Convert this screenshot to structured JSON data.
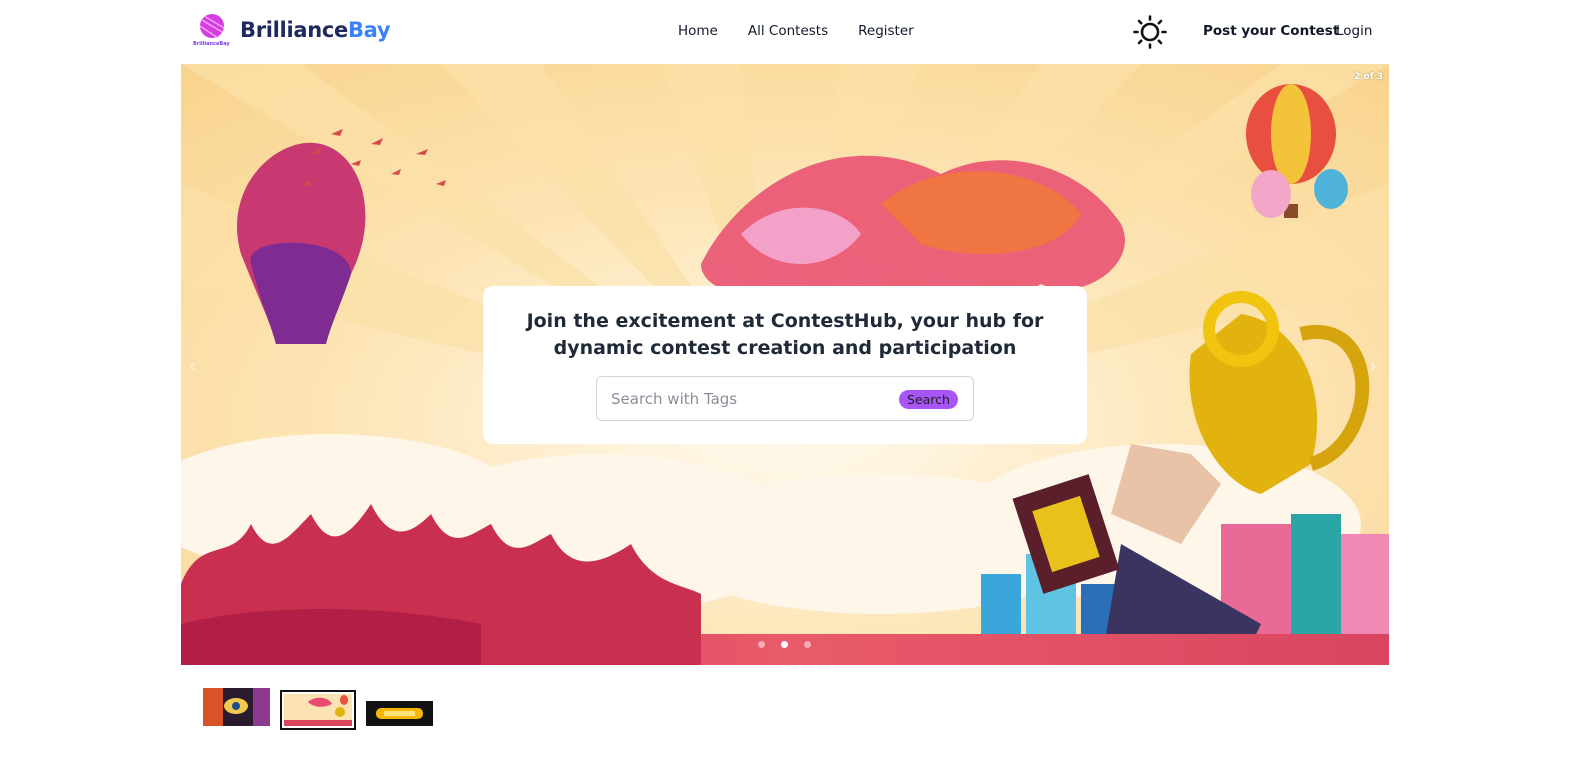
{
  "brand": {
    "part1": "Brilliance",
    "part2": "Bay"
  },
  "nav": {
    "links": [
      "Home",
      "All Contests",
      "Register"
    ],
    "post_contest": "Post your Contest",
    "login": "Login",
    "theme_icon": "sun-icon"
  },
  "carousel": {
    "counter": "2 of 3",
    "active_index": 1,
    "dot_count": 3
  },
  "hero": {
    "title": "Join the excitement at ContestHub, your hub for dynamic contest creation and participation",
    "search_placeholder": "Search with Tags",
    "search_button": "Search"
  },
  "colors": {
    "brand_dark": "#1e2a5e",
    "brand_accent": "#3b82f6",
    "button_purple": "#a855f7"
  }
}
